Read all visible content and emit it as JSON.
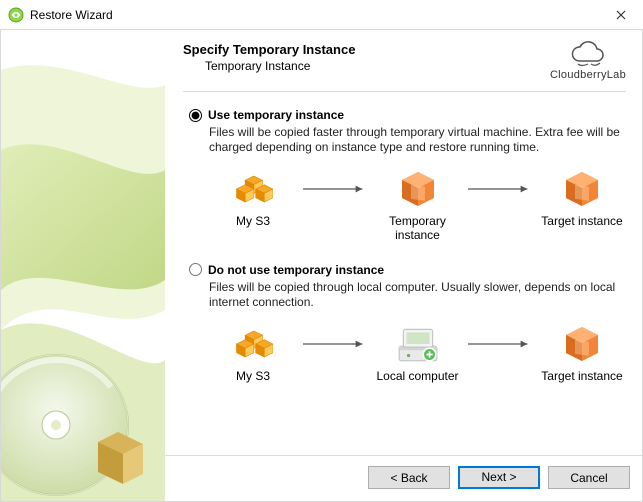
{
  "window": {
    "title": "Restore Wizard"
  },
  "header": {
    "title": "Specify Temporary Instance",
    "subtitle": "Temporary Instance",
    "brand": "CloudberryLab"
  },
  "options": {
    "selected": "use",
    "use": {
      "label": "Use temporary instance",
      "desc": "Files will be copied faster through temporary virtual machine. Extra fee will be charged depending on instance type and restore running time.",
      "flow": {
        "a": "My S3",
        "b": "Temporary instance",
        "c": "Target instance"
      }
    },
    "skip": {
      "label": "Do not use temporary instance",
      "desc": "Files will be copied through local computer. Usually slower, depends on local internet connection.",
      "flow": {
        "a": "My S3",
        "b": "Local computer",
        "c": "Target instance"
      }
    }
  },
  "buttons": {
    "back": "< Back",
    "next": "Next >",
    "cancel": "Cancel"
  }
}
